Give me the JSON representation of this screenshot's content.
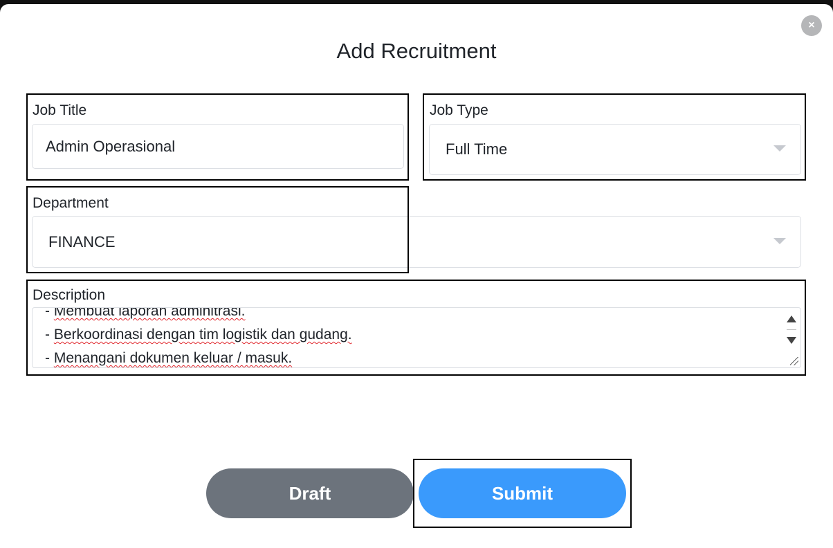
{
  "modal": {
    "title": "Add Recruitment",
    "close_label": "×"
  },
  "form": {
    "job_title": {
      "label": "Job Title",
      "value": "Admin Operasional"
    },
    "job_type": {
      "label": "Job Type",
      "value": "Full Time"
    },
    "department": {
      "label": "Department",
      "value": "FINANCE"
    },
    "description": {
      "label": "Description",
      "lines": [
        "- Membuat laporan adminitrasi.",
        "- Berkoordinasi dengan tim logistik dan gudang.",
        "- Menangani dokumen keluar / masuk."
      ]
    }
  },
  "actions": {
    "draft_label": "Draft",
    "submit_label": "Submit"
  },
  "colors": {
    "draft": "#6c737c",
    "submit": "#3a9afc",
    "spellcheck": "#e0242a"
  },
  "icons": [
    "close-icon",
    "chevron-down-icon",
    "scroll-up-icon",
    "scroll-down-icon",
    "resize-grip-icon"
  ]
}
